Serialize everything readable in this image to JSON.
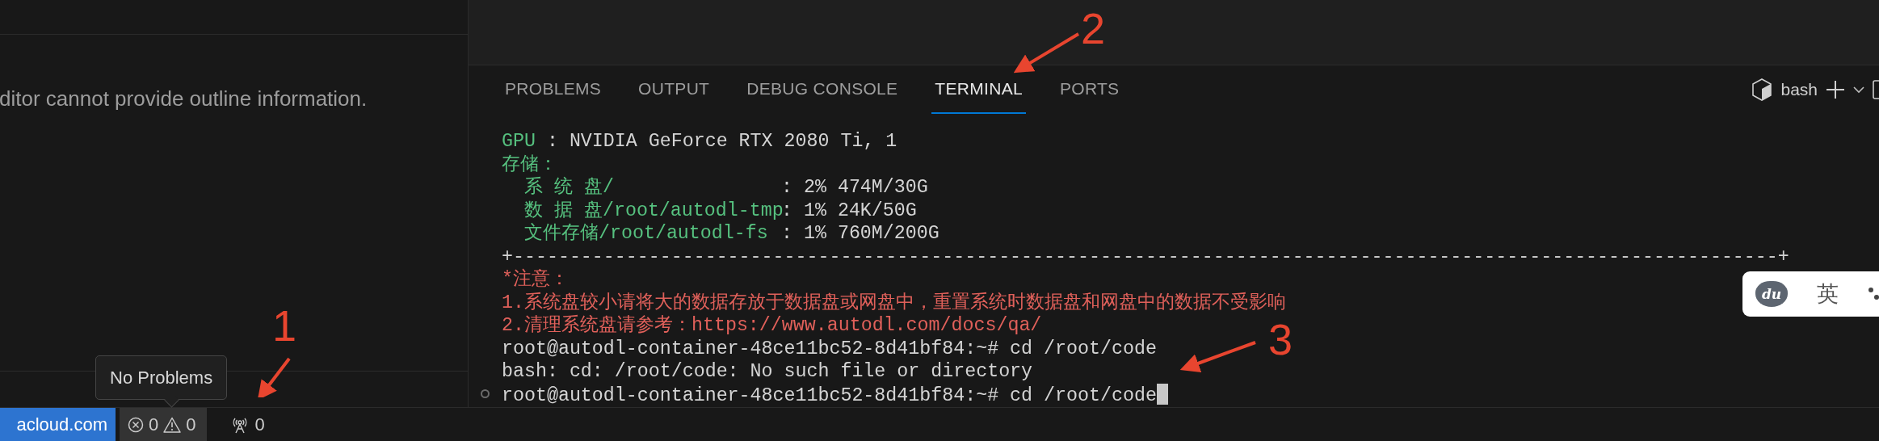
{
  "outline": {
    "message": "ditor cannot provide outline information."
  },
  "panel": {
    "tabs": [
      {
        "label": "PROBLEMS",
        "selected": false
      },
      {
        "label": "OUTPUT",
        "selected": false
      },
      {
        "label": "DEBUG CONSOLE",
        "selected": false
      },
      {
        "label": "TERMINAL",
        "selected": true
      },
      {
        "label": "PORTS",
        "selected": false
      }
    ],
    "terminal_profile": "bash",
    "terminal": {
      "lines": [
        {
          "marker": false,
          "cursor": false,
          "segments": [
            {
              "kind": "label",
              "text": "GPU"
            },
            {
              "kind": "value",
              "text": " : NVIDIA GeForce RTX 2080 Ti, 1"
            }
          ]
        },
        {
          "marker": false,
          "cursor": false,
          "segments": [
            {
              "kind": "label",
              "text": "存储："
            }
          ]
        },
        {
          "marker": false,
          "cursor": false,
          "segments": [
            {
              "kind": "field",
              "text": "系 统 盘/"
            },
            {
              "kind": "value",
              "text": ": 2% 474M/30G"
            }
          ]
        },
        {
          "marker": false,
          "cursor": false,
          "segments": [
            {
              "kind": "field",
              "text": "数 据 盘/root/autodl-tmp"
            },
            {
              "kind": "value",
              "text": ": 1% 24K/50G"
            }
          ]
        },
        {
          "marker": false,
          "cursor": false,
          "segments": [
            {
              "kind": "field",
              "text": "文件存储/root/autodl-fs"
            },
            {
              "kind": "value",
              "text": ": 1% 760M/200G"
            }
          ]
        },
        {
          "marker": false,
          "cursor": false,
          "segments": [
            {
              "kind": "value",
              "text": "+----------------------------------------------------------------------------------------------------------------+"
            }
          ]
        },
        {
          "marker": false,
          "cursor": false,
          "segments": [
            {
              "kind": "warn",
              "text": "*注意："
            }
          ]
        },
        {
          "marker": false,
          "cursor": false,
          "segments": [
            {
              "kind": "warn",
              "text": "1.系统盘较小请将大的数据存放于数据盘或网盘中，重置系统时数据盘和网盘中的数据不受影响"
            }
          ]
        },
        {
          "marker": false,
          "cursor": false,
          "segments": [
            {
              "kind": "warn",
              "text": "2.清理系统盘请参考：https://www.autodl.com/docs/qa/"
            }
          ]
        },
        {
          "marker": false,
          "cursor": false,
          "segments": [
            {
              "kind": "value",
              "text": "root@autodl-container-48ce11bc52-8d41bf84:~# cd /root/code"
            }
          ]
        },
        {
          "marker": false,
          "cursor": false,
          "segments": [
            {
              "kind": "value",
              "text": "bash: cd: /root/code: No such file or directory"
            }
          ]
        },
        {
          "marker": true,
          "cursor": true,
          "segments": [
            {
              "kind": "value",
              "text": "root@autodl-container-48ce11bc52-8d41bf84:~# cd /root/code"
            }
          ]
        }
      ]
    }
  },
  "status_bar": {
    "remote": "acloud.com",
    "errors": "0",
    "warnings": "0",
    "ports": "0"
  },
  "tooltip": "No Problems",
  "ime": {
    "logo": "du",
    "mode": "英"
  },
  "annotations": [
    {
      "label": "1"
    },
    {
      "label": "2"
    },
    {
      "label": "3"
    }
  ]
}
